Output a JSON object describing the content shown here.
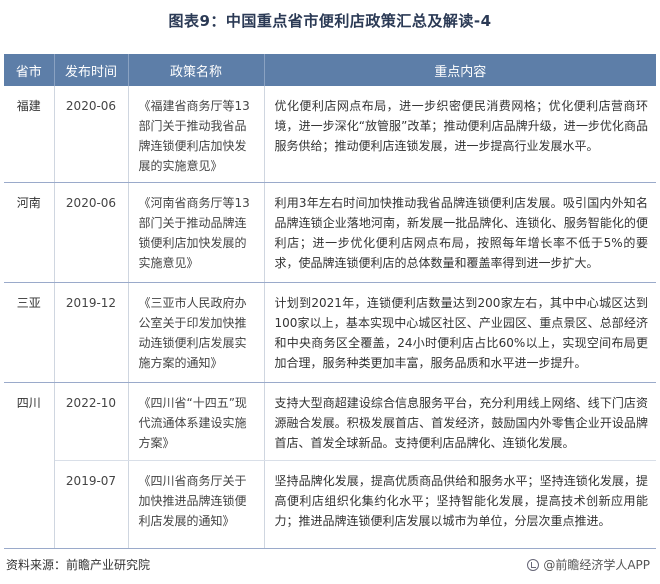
{
  "title": "图表9：中国重点省市便利店政策汇总及解读-4",
  "table": {
    "headers": [
      "省市",
      "发布时间",
      "政策名称",
      "重点内容"
    ],
    "rows": [
      {
        "province": "福建",
        "date": "2020-06",
        "policy": "《福建省商务厅等13部门关于推动我省品牌连锁便利店加快发展的实施意见》",
        "content": "优化便利店网点布局，进一步织密便民消费网格；优化便利店营商环境，进一步深化“放管服”改革；推动便利店品牌升级，进一步优化商品服务供给；推动便利店连锁发展，进一步提高行业发展水平。"
      },
      {
        "province": "河南",
        "date": "2020-06",
        "policy": "《河南省商务厅等13部门关于推动品牌连锁便利店加快发展的实施意见》",
        "content": "利用3年左右时间加快推动我省品牌连锁便利店发展。吸引国内外知名品牌连锁企业落地河南，新发展一批品牌化、连锁化、服务智能化的便利店；进一步优化便利店网点布局，按照每年增长率不低于5%的要求，使品牌连锁便利店的总体数量和覆盖率得到进一步扩大。"
      },
      {
        "province": "三亚",
        "date": "2019-12",
        "policy": "《三亚市人民政府办公室关于印发加快推动连锁便利店发展实施方案的通知》",
        "content": "计划到2021年，连锁便利店数量达到200家左右，其中中心城区达到100家以上，基本实现中心城区社区、产业园区、重点景区、总部经济和中央商务区全覆盖，24小时便利店占比60%以上，实现空间布局更加合理，服务种类更加丰富，服务品质和水平进一步提升。"
      },
      {
        "province": "四川",
        "date": "2022-10",
        "policy": "《四川省“十四五”现代流通体系建设实施方案》",
        "content": "支持大型商超建设综合信息服务平台，充分利用线上网络、线下门店资源融合发展。积极发展首店、首发经济，鼓励国内外零售企业开设品牌首店、首发全球新品。支持便利店品牌化、连锁化发展。"
      },
      {
        "province": "",
        "date": "2019-07",
        "policy": "《四川省商务厅关于加快推进品牌连锁便利店发展的通知》",
        "content": "坚持品牌化发展，提高优质商品供给和服务水平；坚持连锁化发展，提高便利店组织化集约化水平；坚持智能化发展，提高技术创新应用能力；推进品牌连锁便利店发展以城市为单位，分层次重点推进。"
      }
    ]
  },
  "footer": {
    "source": "资料来源：前瞻产业研究院",
    "brand": "@前瞻经济学人APP",
    "brand_icon": "qianzhan-logo-icon"
  },
  "colors": {
    "header_bg": "#5d7ea8",
    "title": "#2b3a55"
  }
}
